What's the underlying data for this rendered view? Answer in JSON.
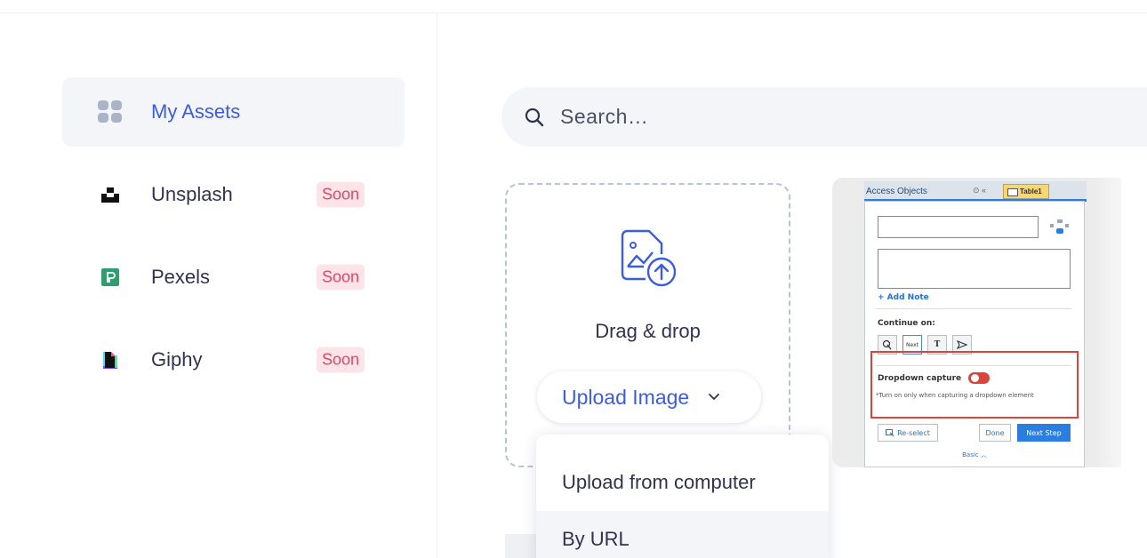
{
  "sidebar": {
    "items": [
      {
        "label": "My Assets",
        "icon": "grid-icon",
        "active": true,
        "badge": ""
      },
      {
        "label": "Unsplash",
        "icon": "unsplash-logo",
        "active": false,
        "badge": "Soon"
      },
      {
        "label": "Pexels",
        "icon": "pexels-logo",
        "active": false,
        "badge": "Soon"
      },
      {
        "label": "Giphy",
        "icon": "giphy-logo",
        "active": false,
        "badge": "Soon"
      }
    ]
  },
  "search": {
    "placeholder": "Search…",
    "icon": "search-icon"
  },
  "dropzone": {
    "icon": "image-upload-icon",
    "text": "Drag & drop",
    "upload_label": "Upload Image"
  },
  "upload_menu": {
    "items": [
      "Upload from computer",
      "By URL"
    ]
  },
  "thumbnail": {
    "panel_title": "Access Objects",
    "tab_label": "Table1",
    "add_note": "+ Add Note",
    "continue_on": "Continue on:",
    "next_btn": "Next",
    "text_btn": "T",
    "dropdown_capture": "Dropdown capture",
    "dropdown_note": "*Turn on only when capturing a dropdown element",
    "reselect": "Re-select",
    "done": "Done",
    "next_step": "Next Step",
    "basic": "Basic"
  },
  "colors": {
    "accent": "#3d5ce0",
    "soon_bg": "#fde4e8",
    "soon_text": "#e2476a",
    "surface": "#f4f5f9"
  }
}
